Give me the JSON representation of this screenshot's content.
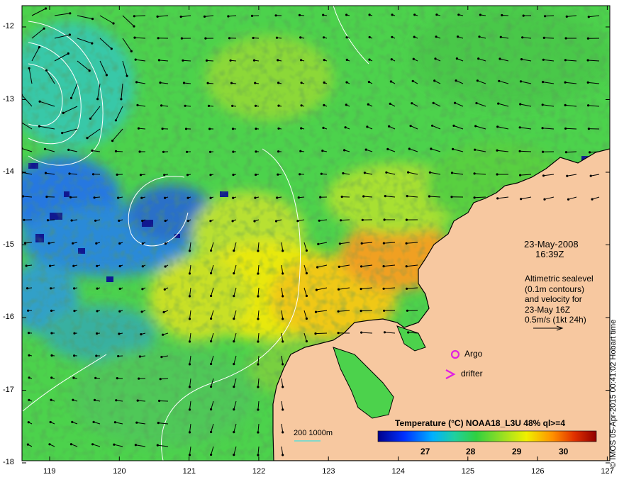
{
  "map": {
    "date": "23-May-2008",
    "time": "16:39Z",
    "altimetry_lines": [
      "Altimetric sealevel",
      "(0.1m contours)",
      "and velocity for",
      "23-May 16Z",
      "0.5m/s (1kt 24h)"
    ],
    "legend_argo": "Argo",
    "legend_drifter": "drifter",
    "bathy_label": "200  1000m",
    "colorbar_title": "Temperature (°C) NOAA18_L3U 48% ql>=4",
    "colorbar_ticks": [
      "27",
      "28",
      "29",
      "30"
    ],
    "credit": "© IMOS 05-Apr-2015 00:41:02 Hobart time",
    "lat_ticks": [
      "-12",
      "-13",
      "-14",
      "-15",
      "-16",
      "-17",
      "-18"
    ],
    "lon_ticks": [
      "119",
      "120",
      "121",
      "122",
      "123",
      "124",
      "125",
      "126",
      "127"
    ],
    "colors": {
      "land": "#f7c8a0",
      "argo": "#e020e0",
      "drifter": "#e020e0",
      "bathy": "#40e0e0",
      "contour": "#ffffff"
    }
  }
}
